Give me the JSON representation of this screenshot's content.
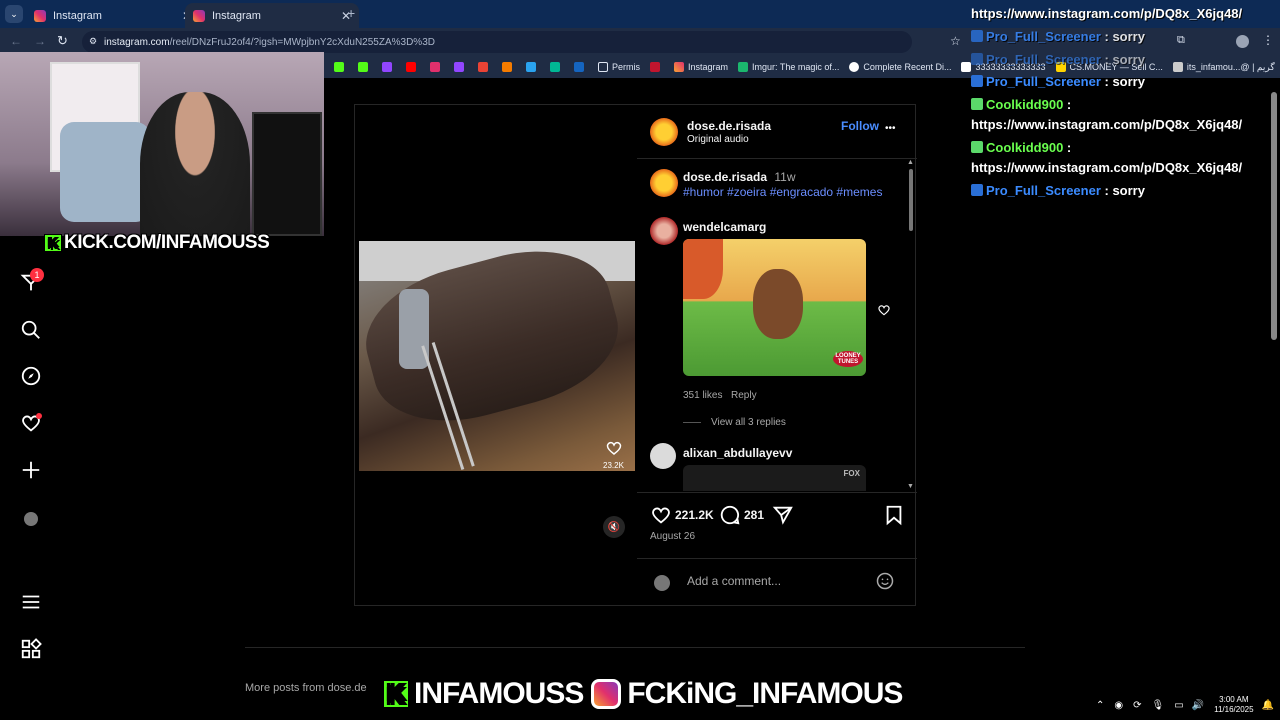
{
  "browser": {
    "tabs": [
      {
        "title": "Instagram",
        "active": false
      },
      {
        "title": "Instagram",
        "active": true
      }
    ],
    "new_tab": "+",
    "url_host": "instagram.com",
    "url_path": "/reel/DNzFruJ2of4/?igsh=MWpjbnY2cXduN255ZA%3D%3D",
    "bookmarks": [
      "Permis",
      "Instagram",
      "Imgur: The magic of...",
      "Complete Recent Di...",
      "33333333333333",
      "CS.MONEY — Sell C...",
      "its_infamou...@ | گریم"
    ],
    "more": "»"
  },
  "stream": {
    "kick_banner": "KICK.COM/INFAMOUSS",
    "kick_letter": "K",
    "bottom_kick": "INFAMOUSS",
    "bottom_ig": "FCKiNG_INFAMOUS"
  },
  "sidebar": {
    "notification_count": "1"
  },
  "post": {
    "author": "dose.de.risada",
    "audio": "Original audio",
    "follow_label": "Follow",
    "more_label": "•••",
    "video_likes": "23.2K",
    "caption_user": "dose.de.risada",
    "caption_age": "11w",
    "caption_tags": "#humor #zoeira #engracado #memes",
    "comments": [
      {
        "user": "wendelcamarg",
        "likes": "351 likes",
        "reply": "Reply",
        "view_replies": "View all 3 replies"
      },
      {
        "user": "alixan_abdullayevv",
        "media_label": "FOX"
      }
    ],
    "gif_label": "LOONEY TUNES",
    "like_count": "221.2K",
    "comment_count": "281",
    "date": "August 26",
    "add_comment_placeholder": "Add a comment..."
  },
  "chat": [
    {
      "user": "",
      "text": "https://www.instagram.com/p/DQ8x_X6jq48/"
    },
    {
      "user": "Pro_Full_Screener",
      "text": ": sorry"
    },
    {
      "user": "Pro_Full_Screener",
      "text": ": sorry"
    },
    {
      "user": "Pro_Full_Screener",
      "text": ": sorry"
    },
    {
      "user": "Coolkidd900",
      "text": ":"
    },
    {
      "user": "",
      "text": "https://www.instagram.com/p/DQ8x_X6jq48/"
    },
    {
      "user": "Coolkidd900",
      "text": ":"
    },
    {
      "user": "",
      "text": "https://www.instagram.com/p/DQ8x_X6jq48/"
    },
    {
      "user": "Pro_Full_Screener",
      "text": ": sorry"
    }
  ],
  "more_posts": "More posts from dose.de",
  "taskbar": {
    "time": "3:00 AM",
    "date": "11/16/2025"
  },
  "colors": {
    "kick_green": "#53fc18",
    "link_blue": "#4a8dff",
    "chrome_dark": "#0d2a55"
  }
}
